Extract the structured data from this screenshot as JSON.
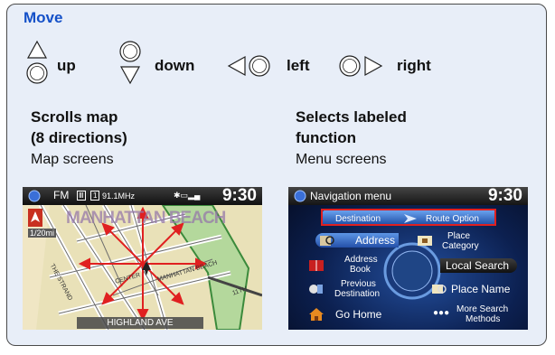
{
  "title": "Move",
  "directions": [
    {
      "label": "up"
    },
    {
      "label": "down"
    },
    {
      "label": "left"
    },
    {
      "label": "right"
    }
  ],
  "left": {
    "heading_line1": "Scrolls map",
    "heading_line2": "(8 directions)",
    "sub": "Map screens",
    "screen": {
      "source": "FM",
      "preset": "1",
      "freq": "91.1MHz",
      "time": "9:30",
      "scale": "1/20mi",
      "area": "MANHATTAN BEACH",
      "street_bottom": "HIGHLAND AVE",
      "street_center": "CENTER",
      "street_strand": "THE STRAND",
      "street_11th": "11TH",
      "street_mb": "MANHATTAN BEACH"
    }
  },
  "right": {
    "heading_line1": "Selects labeled",
    "heading_line2": "function",
    "sub": "Menu screens",
    "screen": {
      "title": "Navigation menu",
      "time": "9:30",
      "tab_destination": "Destination",
      "tab_route": "Route Option",
      "items": {
        "address": "Address",
        "place_category_1": "Place",
        "place_category_2": "Category",
        "address_book_1": "Address",
        "address_book_2": "Book",
        "local_search": "Local Search",
        "previous_dest_1": "Previous",
        "previous_dest_2": "Destination",
        "place_name": "Place Name",
        "go_home": "Go Home",
        "more_search_1": "More Search",
        "more_search_2": "Methods"
      }
    }
  },
  "colors": {
    "title": "#1450c8",
    "panel_bg": "#e8eef8",
    "highlight": "#e02020"
  }
}
